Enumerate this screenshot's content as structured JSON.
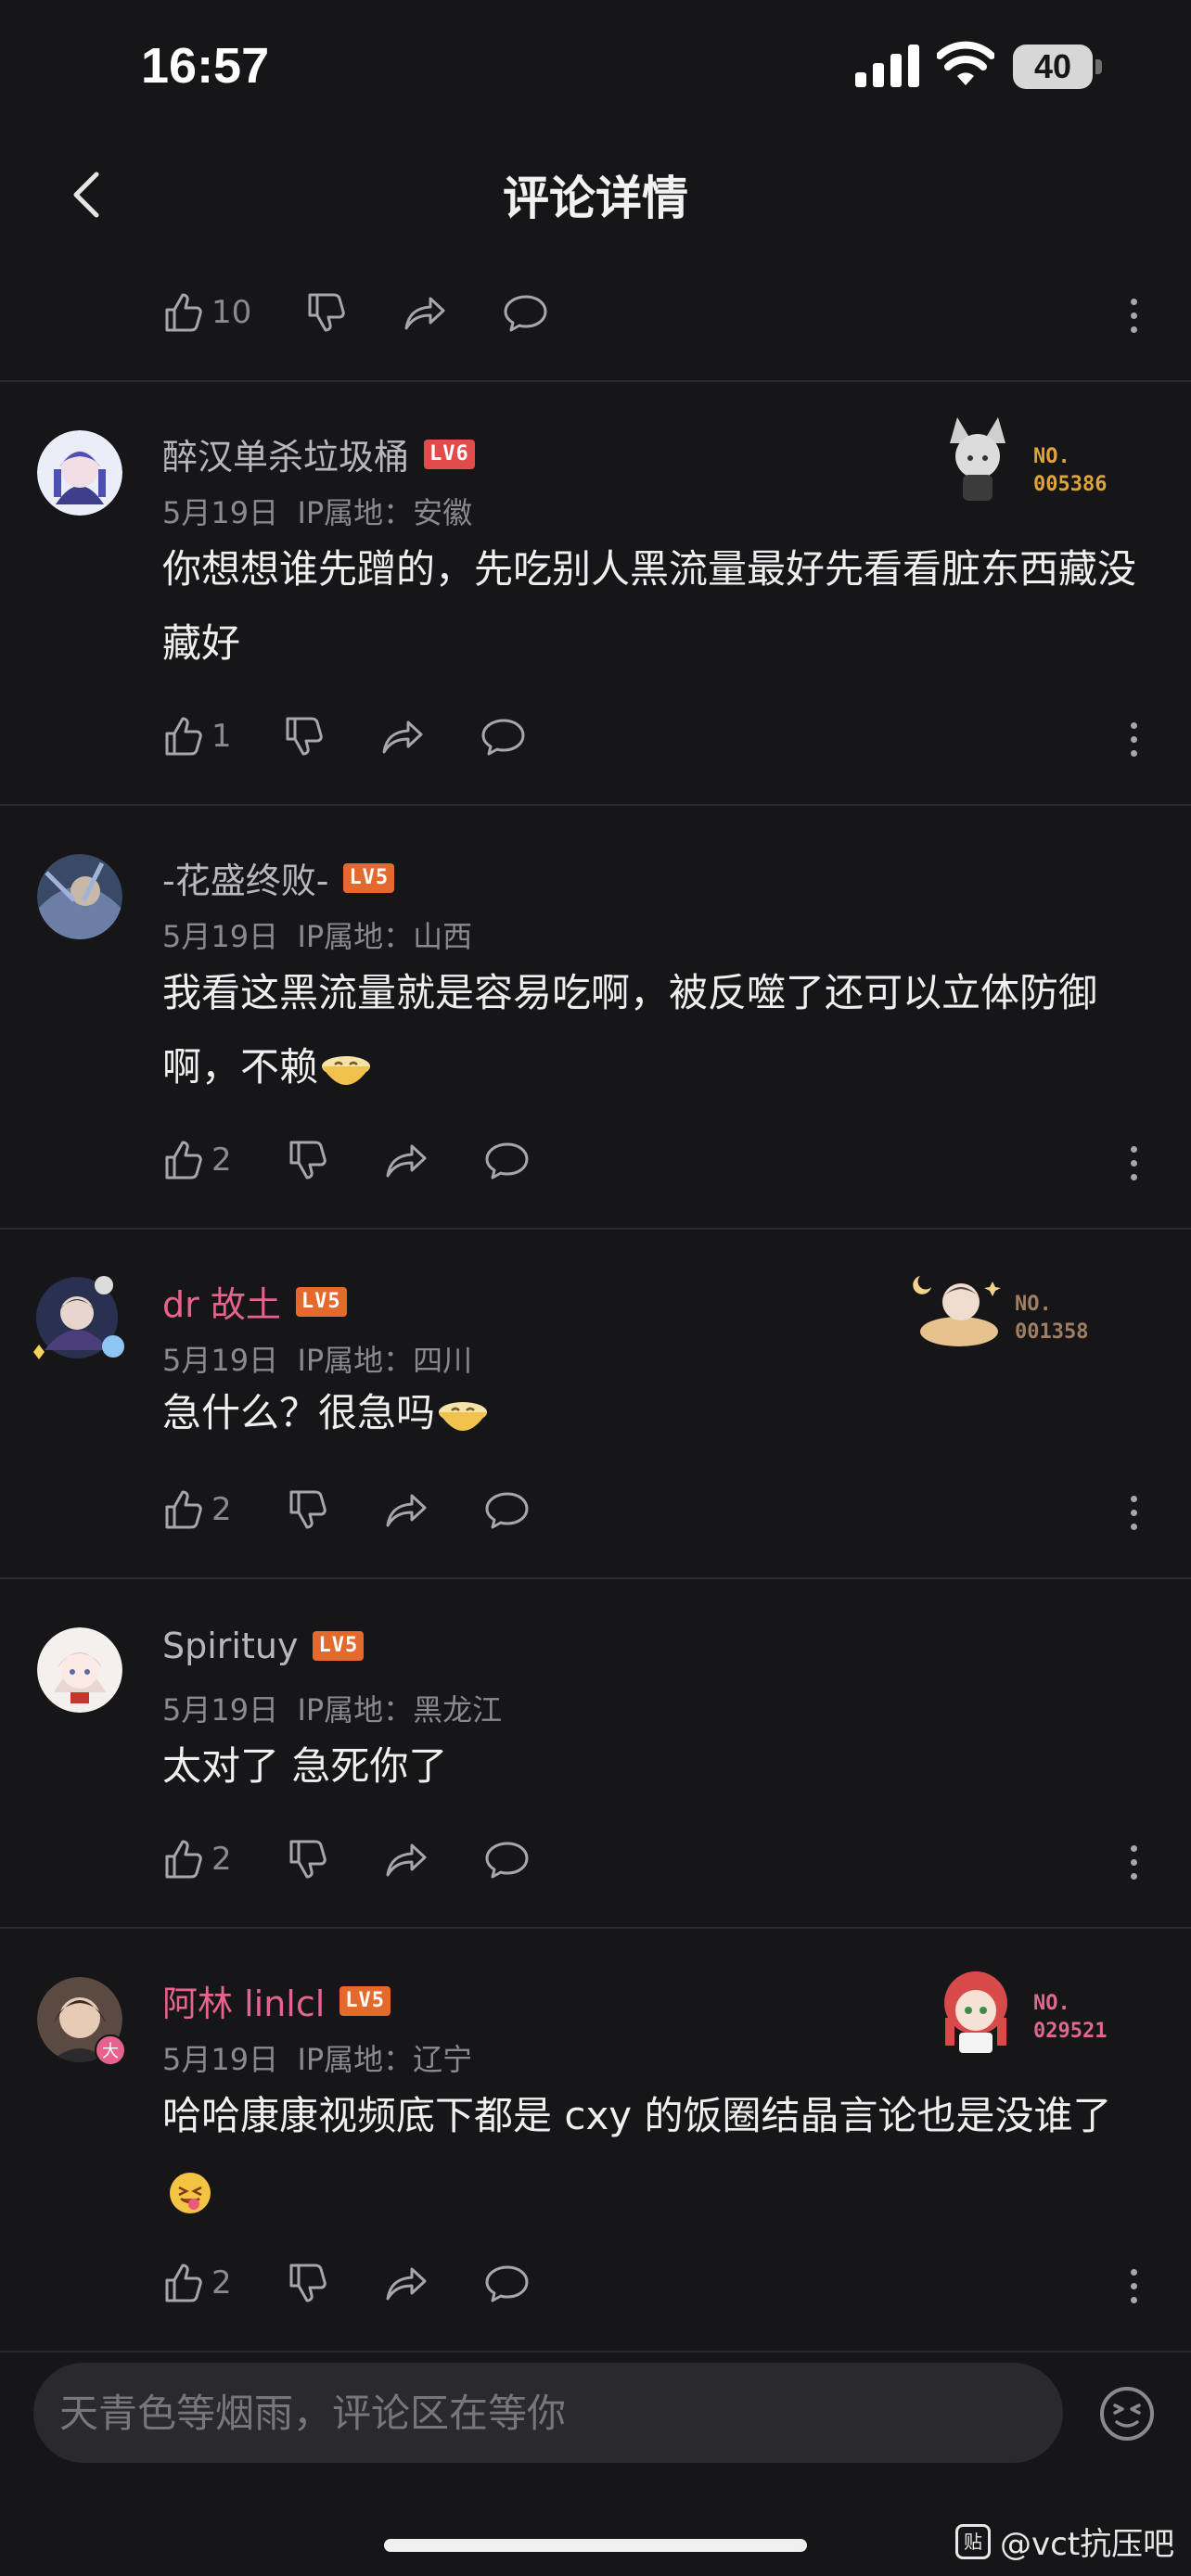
{
  "status_bar": {
    "time": "16:57",
    "battery": "40"
  },
  "nav": {
    "title": "评论详情"
  },
  "top_actions": {
    "likes": "10"
  },
  "comments": [
    {
      "name": "醉汉单杀垃圾桶",
      "level": "LV6",
      "date": "5月19日",
      "ip": "IP属地：安徽",
      "text": "你想想谁先蹭的，先吃别人黑流量最好先看看脏东西藏没藏好",
      "likes": "1",
      "badge_no": "NO.",
      "badge_num": "005386"
    },
    {
      "name": "-花盛终败-",
      "level": "LV5",
      "date": "5月19日",
      "ip": "IP属地：山西",
      "text": "我看这黑流量就是容易吃啊，被反噬了还可以立体防御啊，不赖",
      "likes": "2"
    },
    {
      "name": "dr 故土",
      "level": "LV5",
      "date": "5月19日",
      "ip": "IP属地：四川",
      "text": "急什么？很急吗",
      "likes": "2",
      "badge_no": "NO.",
      "badge_num": "001358"
    },
    {
      "name": "Spirituy",
      "level": "LV5",
      "date": "5月19日",
      "ip": "IP属地：黑龙江",
      "text": "太对了 急死你了",
      "likes": "2"
    },
    {
      "name": "阿林 linlcl",
      "level": "LV5",
      "date": "5月19日",
      "ip": "IP属地：辽宁",
      "text": "哈哈康康视频底下都是 cxy 的饭圈结晶言论也是没谁了",
      "likes": "2",
      "badge_no": "NO.",
      "badge_num": "029521",
      "avatar_tag": "大"
    }
  ],
  "input": {
    "placeholder": "天青色等烟雨，评论区在等你"
  },
  "watermark": {
    "icon_text": "贴",
    "text": "@vct抗压吧"
  },
  "colors": {
    "background": "#161618",
    "pink_name": "#e8628f",
    "level_red": "#e24b4b",
    "level_orange": "#e36a2c",
    "badge_gold": "#e0a33a",
    "badge_brown": "#a07e63",
    "badge_pink": "#e0688c"
  },
  "icons": [
    "signal-icon",
    "wifi-icon",
    "battery-icon",
    "back-chevron-icon",
    "thumbs-up-icon",
    "thumbs-down-icon",
    "share-icon",
    "comment-bubble-icon",
    "more-dots-icon",
    "emoji-icon"
  ]
}
